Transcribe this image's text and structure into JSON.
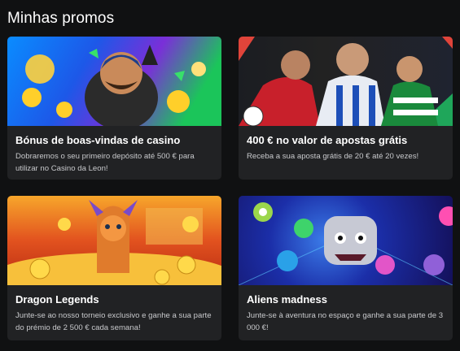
{
  "page": {
    "title": "Minhas promos"
  },
  "promos": [
    {
      "title": "Bónus de boas-vindas de casino",
      "description": "Dobraremos o seu primeiro depósito até 500 € para utilizar no Casino da Leon!",
      "image_icon": "casino-character-illustration"
    },
    {
      "title": "400 € no valor de apostas grátis",
      "description": "Receba a sua aposta grátis de 20 € até 20 vezes!",
      "image_icon": "football-players-illustration"
    },
    {
      "title": "Dragon Legends",
      "description": "Junte-se ao nosso torneio exclusivo e ganhe a sua parte do prémio de 2 500 € cada semana!",
      "image_icon": "dragon-gold-coins-illustration"
    },
    {
      "title": "Aliens madness",
      "description": "Junte-se à aventura no espaço e ganhe a sua parte de 3 000 €!",
      "image_icon": "aliens-space-illustration"
    }
  ],
  "colors": {
    "background": "#101112",
    "card": "#212224",
    "text": "#ffffff",
    "muted": "#c8c9cc"
  }
}
